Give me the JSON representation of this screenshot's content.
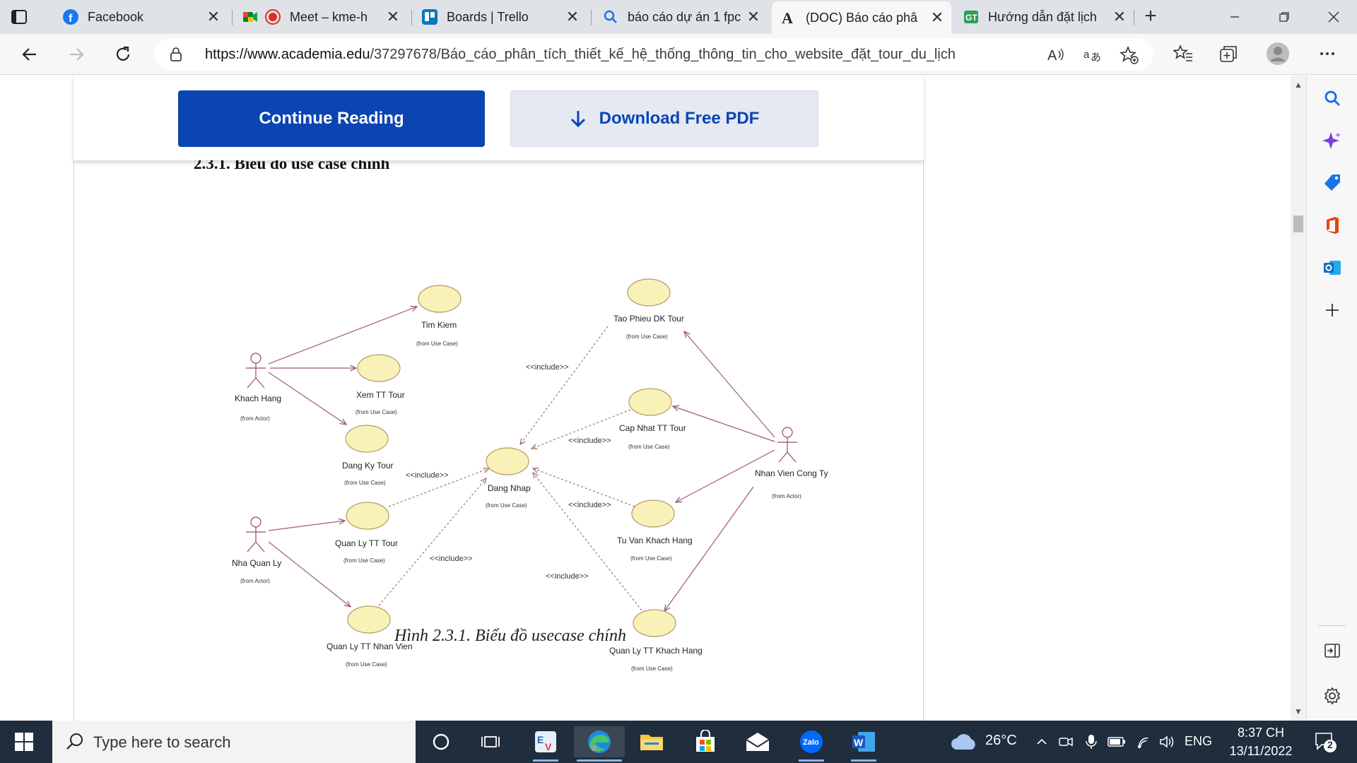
{
  "browser": {
    "tabs": [
      {
        "title": "Facebook",
        "icon": "facebook-icon",
        "active": false
      },
      {
        "title": "Meet – kme-h",
        "icon": "meet-icon",
        "active": false
      },
      {
        "title": "Boards | Trello",
        "icon": "trello-icon",
        "active": false
      },
      {
        "title": "báo cáo dự án 1 fpc",
        "icon": "search-icon",
        "active": false
      },
      {
        "title": "(DOC) Báo cáo phâ",
        "icon": "academia-icon",
        "active": true
      },
      {
        "title": "Hướng dẫn đặt lịch",
        "icon": "guide-icon",
        "active": false
      }
    ],
    "url_host": "https://www.academia.edu",
    "url_path": "/37297678/Báo_cáo_phân_tích_thiết_kế_hệ_thống_thông_tin_cho_website_đặt_tour_du_lịch"
  },
  "page": {
    "continue_label": "Continue Reading",
    "download_label": "Download Free PDF",
    "section_heading": "2.3.1. Biểu đồ use case chính",
    "caption": "Hình 2.3.1. Biểu đồ usecase chính"
  },
  "diagram": {
    "actors": [
      {
        "name": "Khach Hang",
        "note": "(from Actor)"
      },
      {
        "name": "Nha Quan Ly",
        "note": "(from Actor)"
      },
      {
        "name": "Nhan Vien Cong Ty",
        "note": "(from Actor)"
      }
    ],
    "use_cases": [
      {
        "name": "Tim Kiem",
        "note": "(from Use Case)"
      },
      {
        "name": "Xem TT Tour",
        "note": "(from Use Case)"
      },
      {
        "name": "Dang Ky Tour",
        "note": "(from Use Case)"
      },
      {
        "name": "Quan Ly TT Tour",
        "note": "(from Use Case)"
      },
      {
        "name": "Quan Ly TT Nhan Vien",
        "note": "(from Use Case)"
      },
      {
        "name": "Dang Nhap",
        "note": "(from Use Case)"
      },
      {
        "name": "Tao Phieu DK Tour",
        "note": "(from Use Case)"
      },
      {
        "name": "Cap Nhat TT Tour",
        "note": "(from Use Case)"
      },
      {
        "name": "Tu Van Khach Hang",
        "note": "(from Use Case)"
      },
      {
        "name": "Quan Ly TT Khach Hang",
        "note": "(from Use Case)"
      }
    ],
    "include_label": "<<include>>"
  },
  "taskbar": {
    "search_placeholder": "Type here to search",
    "weather": "26°C",
    "language": "ENG",
    "time": "8:37 CH",
    "date": "13/11/2022",
    "notifications": "2"
  },
  "colors": {
    "primary_button": "#0b45b4",
    "secondary_button": "#e4e9f2",
    "taskbar": "#1f2d3d"
  }
}
